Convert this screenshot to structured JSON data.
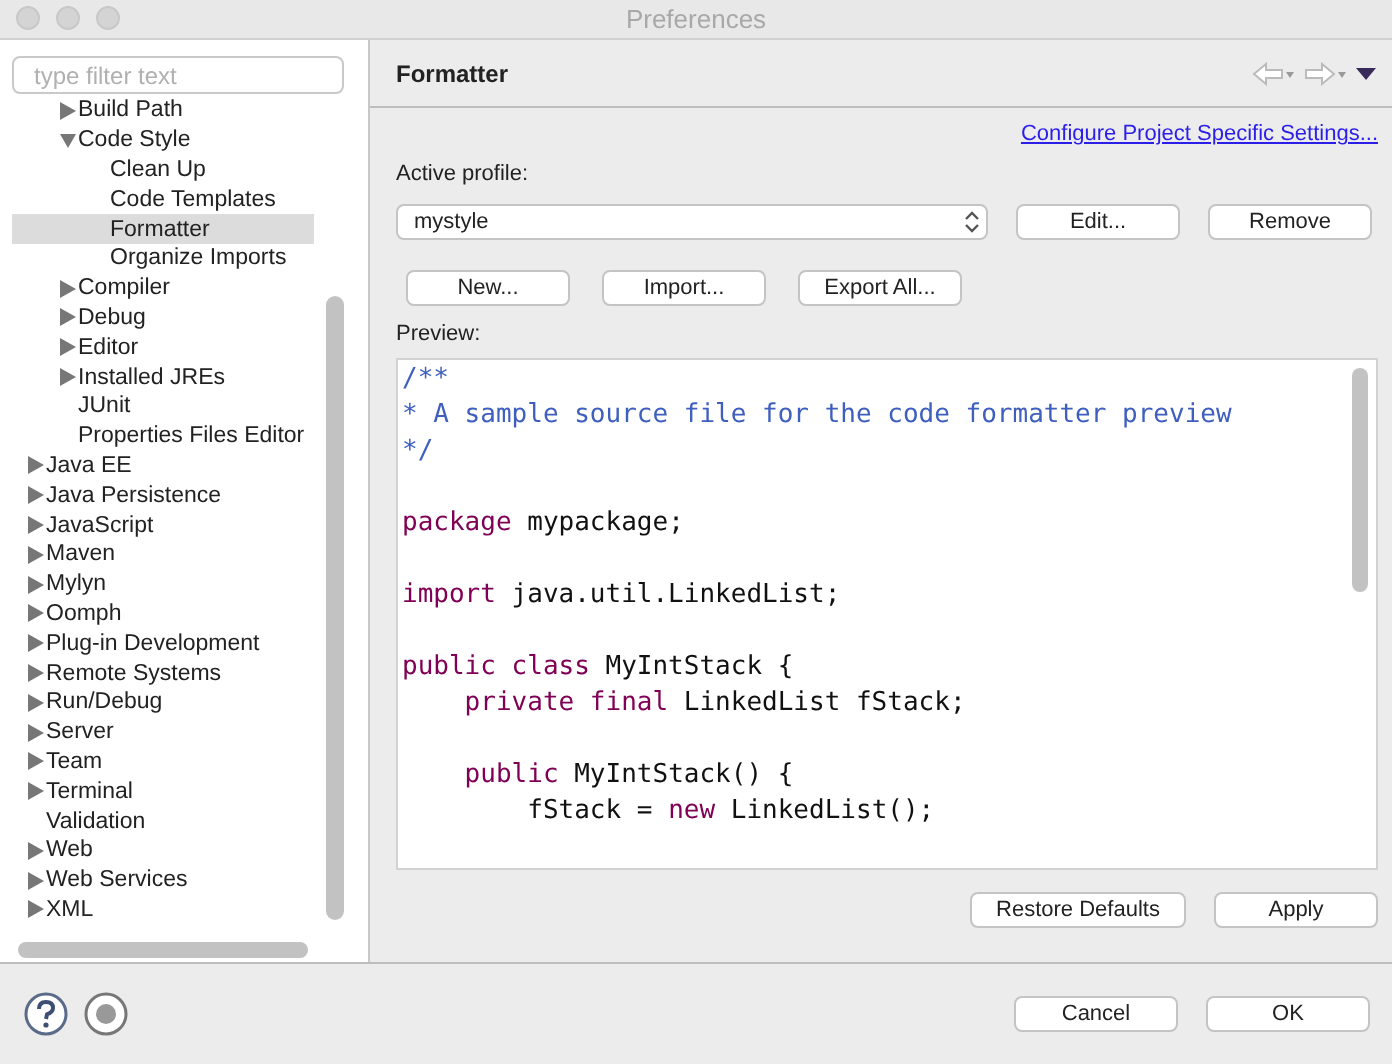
{
  "window": {
    "title": "Preferences"
  },
  "sidebar": {
    "filter": {
      "placeholder": "type filter text"
    },
    "scrolled_parent_children": [
      {
        "label": "Build Path",
        "expanded": false,
        "selected": false
      },
      {
        "label": "Code Style",
        "expanded": true,
        "selected": false,
        "children": [
          {
            "label": "Clean Up",
            "selected": false
          },
          {
            "label": "Code Templates",
            "selected": false
          },
          {
            "label": "Formatter",
            "selected": true
          },
          {
            "label": "Organize Imports",
            "selected": false
          }
        ]
      },
      {
        "label": "Compiler",
        "expanded": false,
        "selected": false
      },
      {
        "label": "Debug",
        "expanded": false,
        "selected": false
      },
      {
        "label": "Editor",
        "expanded": false,
        "selected": false
      },
      {
        "label": "Installed JREs",
        "expanded": false,
        "selected": false
      },
      {
        "label": "JUnit",
        "selected": false
      },
      {
        "label": "Properties Files Editor",
        "selected": false
      }
    ],
    "items": [
      {
        "label": "Java EE",
        "expanded": false,
        "selected": false
      },
      {
        "label": "Java Persistence",
        "expanded": false,
        "selected": false
      },
      {
        "label": "JavaScript",
        "expanded": false,
        "selected": false
      },
      {
        "label": "Maven",
        "expanded": false,
        "selected": false
      },
      {
        "label": "Mylyn",
        "expanded": false,
        "selected": false
      },
      {
        "label": "Oomph",
        "expanded": false,
        "selected": false
      },
      {
        "label": "Plug-in Development",
        "expanded": false,
        "selected": false
      },
      {
        "label": "Remote Systems",
        "expanded": false,
        "selected": false
      },
      {
        "label": "Run/Debug",
        "expanded": false,
        "selected": false
      },
      {
        "label": "Server",
        "expanded": false,
        "selected": false
      },
      {
        "label": "Team",
        "expanded": false,
        "selected": false
      },
      {
        "label": "Terminal",
        "expanded": false,
        "selected": false
      },
      {
        "label": "Validation",
        "selected": false
      },
      {
        "label": "Web",
        "expanded": false,
        "selected": false
      },
      {
        "label": "Web Services",
        "expanded": false,
        "selected": false
      },
      {
        "label": "XML",
        "expanded": false,
        "selected": false
      }
    ]
  },
  "page": {
    "title": "Formatter",
    "link": "Configure Project Specific Settings...",
    "profile_label": "Active profile:",
    "profile_value": "mystyle",
    "profile_buttons": [
      "Edit...",
      "Remove"
    ],
    "buttons": [
      "New...",
      "Import...",
      "Export All..."
    ],
    "preview_label": "Preview:",
    "preview_blocks": [
      {
        "lines": [
          [
            {
              "kind": "comment",
              "text": "/**"
            }
          ],
          [
            {
              "kind": "comment",
              "text": "* A sample source file for the code formatter preview"
            }
          ],
          [
            {
              "kind": "comment",
              "text": "*/"
            }
          ]
        ]
      },
      {
        "lines": [
          [
            {
              "kind": "keyword",
              "text": "package"
            },
            {
              "kind": "plain",
              "text": " mypackage;"
            }
          ]
        ]
      },
      {
        "lines": [
          [
            {
              "kind": "keyword",
              "text": "import"
            },
            {
              "kind": "plain",
              "text": " java.util.LinkedList;"
            }
          ]
        ]
      },
      {
        "lines": [
          [
            {
              "kind": "keyword",
              "text": "public class"
            },
            {
              "kind": "plain",
              "text": " MyIntStack {"
            }
          ],
          [
            {
              "kind": "keyword",
              "text": "    private final"
            },
            {
              "kind": "plain",
              "text": " LinkedList fStack;"
            }
          ]
        ]
      },
      {
        "lines": [
          [
            {
              "kind": "keyword",
              "text": "    public"
            },
            {
              "kind": "plain",
              "text": " MyIntStack() {"
            }
          ],
          [
            {
              "kind": "plain",
              "text": "        fStack = "
            },
            {
              "kind": "keyword",
              "text": "new"
            },
            {
              "kind": "plain",
              "text": " LinkedList();"
            }
          ]
        ]
      }
    ],
    "footer_buttons": [
      "Restore Defaults",
      "Apply"
    ]
  },
  "dialog_buttons": [
    "Cancel",
    "OK"
  ]
}
